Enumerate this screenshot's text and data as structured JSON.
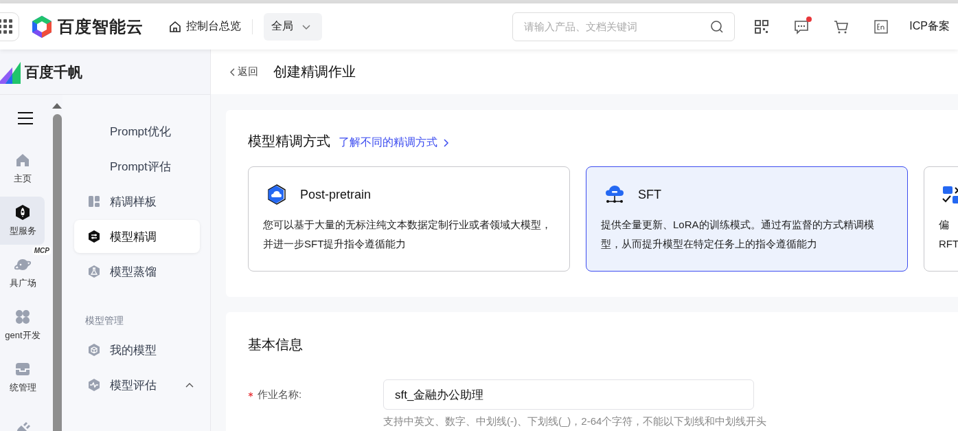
{
  "header": {
    "brand": "百度智能云",
    "console": "控制台总览",
    "scope": "全局",
    "search": {
      "placeholder": "请输入产品、文档关键词"
    },
    "message_unread": true,
    "icp": "ICP备案"
  },
  "sidebar": {
    "product": "百度千帆",
    "rail": [
      {
        "label": "主页",
        "kind": "home",
        "selected": false
      },
      {
        "label": "型服务",
        "kind": "rocket",
        "selected": true
      },
      {
        "label": "具广场",
        "kind": "planet",
        "selected": false,
        "badge": "MCP"
      },
      {
        "label": "gent开发",
        "kind": "grid",
        "selected": false
      },
      {
        "label": "统管理",
        "kind": "inbox",
        "selected": false
      },
      {
        "kind": "plug",
        "selected": false
      }
    ],
    "menu": [
      {
        "kind": "text",
        "label": "Prompt优化",
        "selected": false
      },
      {
        "kind": "text",
        "label": "Prompt评估",
        "selected": false
      },
      {
        "kind": "tiles",
        "label": "精调样板",
        "selected": false
      },
      {
        "kind": "tune",
        "label": "模型精调",
        "selected": true
      },
      {
        "kind": "flask",
        "label": "模型蒸馏",
        "selected": false
      },
      {
        "kind": "group",
        "label": "模型管理"
      },
      {
        "kind": "cube",
        "label": "我的模型",
        "selected": false
      },
      {
        "kind": "pulse",
        "label": "模型评估",
        "selected": false,
        "expanded": true
      }
    ]
  },
  "page": {
    "back": "返回",
    "title": "创建精调作业"
  },
  "method": {
    "title": "模型精调方式",
    "link": "了解不同的精调方式",
    "cards": [
      {
        "kind": "hex-cloud",
        "title": "Post-pretrain",
        "description": "您可以基于大量的无标注纯文本数据定制行业或者领域大模型，并进一步SFT提升指令遵循能力",
        "selected": false
      },
      {
        "kind": "cloud-net",
        "title": "SFT",
        "description": "提供全量更新、LoRA的训练模式。通过有监督的方式精调模型，从而提升模型在特定任务上的指令遵循能力",
        "selected": true
      },
      {
        "kind": "blocks",
        "lines": [
          "偏",
          "RFT"
        ],
        "selected": false
      }
    ]
  },
  "basic": {
    "title": "基本信息",
    "fields": [
      {
        "label": "作业名称:",
        "required": true,
        "value": "sft_金融办公助理",
        "hint": "支持中英文、数字、中划线(-)、下划线(_)，2-64个字符，不能以下划线和中划线开头"
      }
    ]
  }
}
